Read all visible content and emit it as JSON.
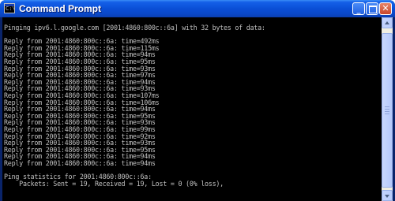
{
  "window": {
    "title": "Command Prompt",
    "icon": "cmd-icon",
    "icon_glyph": "C:\\",
    "buttons": {
      "minimize": "_",
      "maximize": "maximize-icon",
      "close": "✕"
    },
    "colors": {
      "titlebar": "#0a4fd6",
      "console_bg": "#000000",
      "console_text": "#c0c0c0",
      "close_button": "#c6452a"
    }
  },
  "console": {
    "lines": [
      "Pinging ipv6.l.google.com [2001:4860:800c::6a] with 32 bytes of data:",
      "",
      "Reply from 2001:4860:800c::6a: time=492ms",
      "Reply from 2001:4860:800c::6a: time=115ms",
      "Reply from 2001:4860:800c::6a: time=94ms",
      "Reply from 2001:4860:800c::6a: time=95ms",
      "Reply from 2001:4860:800c::6a: time=93ms",
      "Reply from 2001:4860:800c::6a: time=97ms",
      "Reply from 2001:4860:800c::6a: time=94ms",
      "Reply from 2001:4860:800c::6a: time=93ms",
      "Reply from 2001:4860:800c::6a: time=107ms",
      "Reply from 2001:4860:800c::6a: time=106ms",
      "Reply from 2001:4860:800c::6a: time=94ms",
      "Reply from 2001:4860:800c::6a: time=95ms",
      "Reply from 2001:4860:800c::6a: time=93ms",
      "Reply from 2001:4860:800c::6a: time=99ms",
      "Reply from 2001:4860:800c::6a: time=92ms",
      "Reply from 2001:4860:800c::6a: time=93ms",
      "Reply from 2001:4860:800c::6a: time=95ms",
      "Reply from 2001:4860:800c::6a: time=94ms",
      "Reply from 2001:4860:800c::6a: time=94ms",
      "",
      "Ping statistics for 2001:4860:800c::6a:",
      "    Packets: Sent = 19, Received = 19, Lost = 0 (0% loss),"
    ]
  },
  "scrollbar": {
    "up_icon": "scroll-up-arrow-icon",
    "down_icon": "scroll-down-arrow-icon"
  }
}
